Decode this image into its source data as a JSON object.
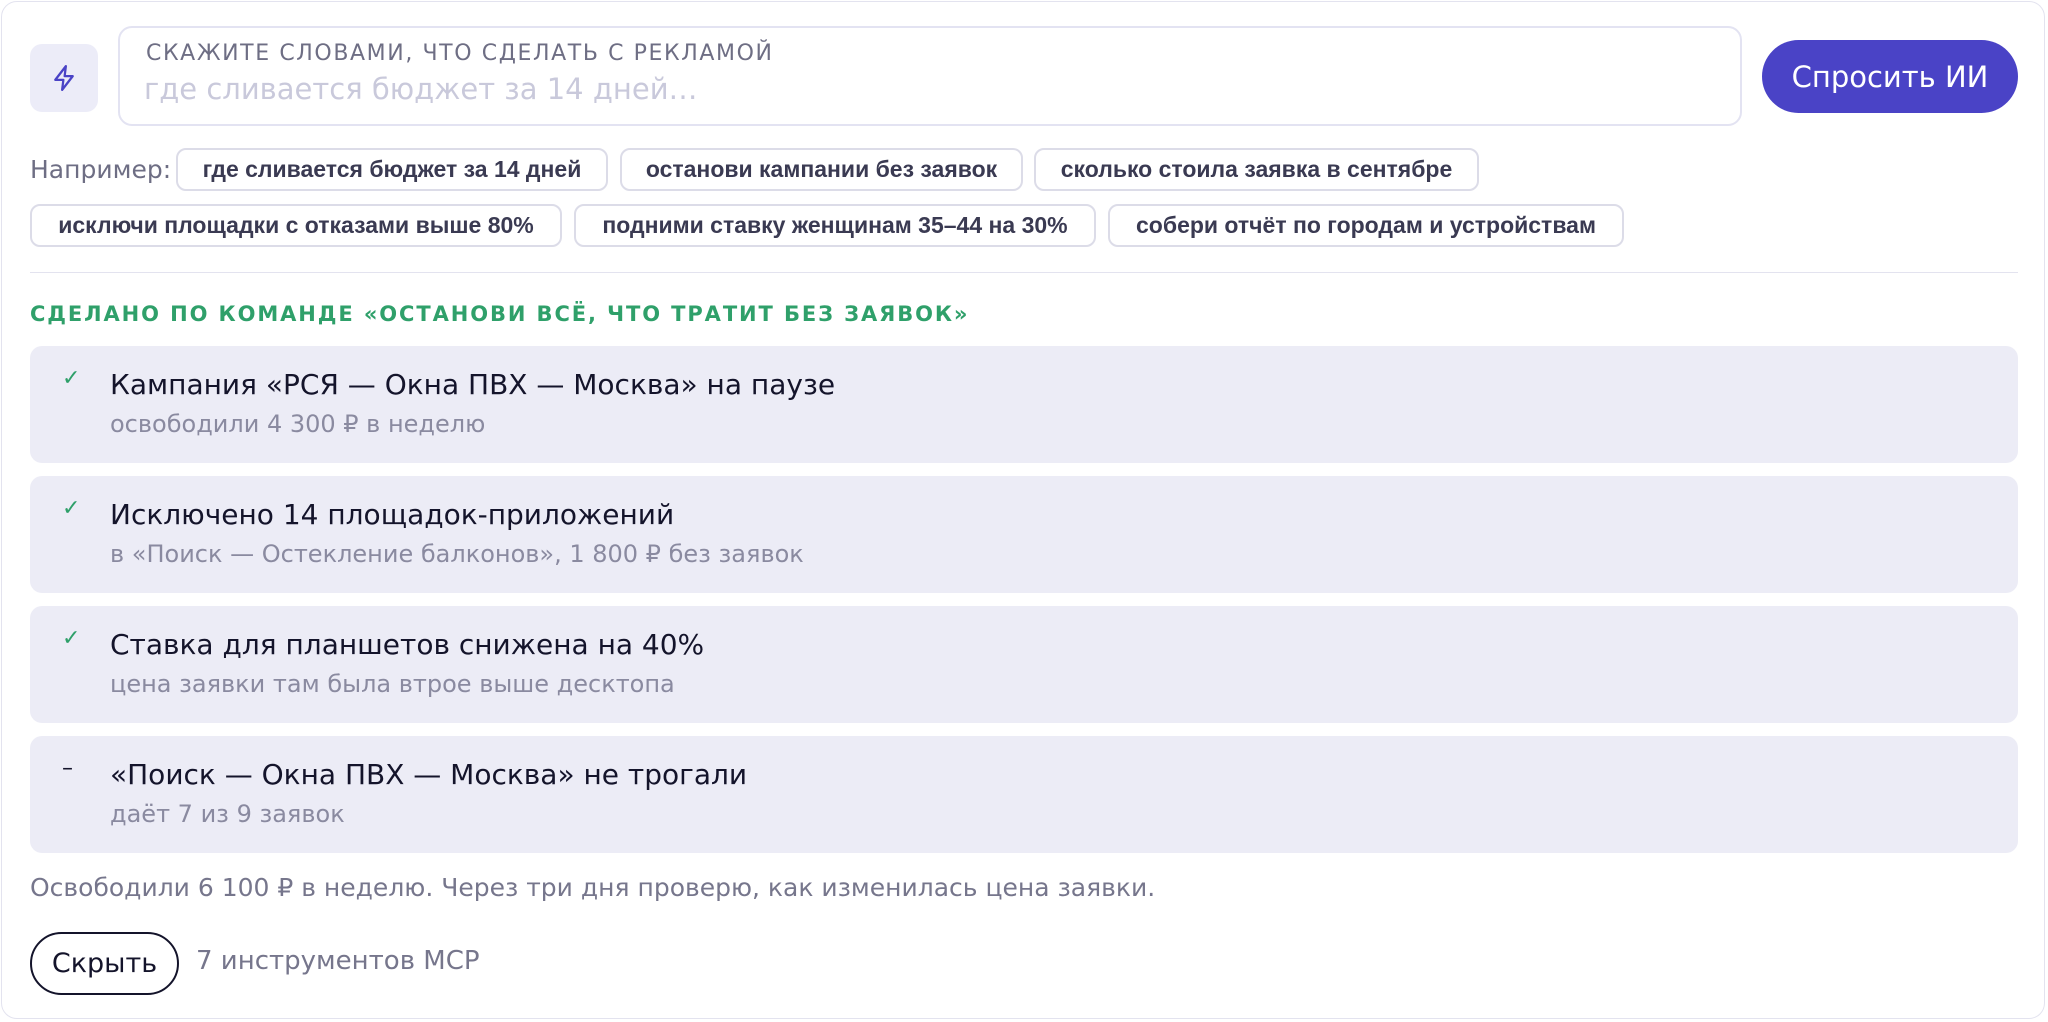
{
  "command_bar": {
    "label": "СКАЖИТЕ СЛОВАМИ, ЧТО СДЕЛАТЬ С РЕКЛАМОЙ",
    "placeholder": "где сливается бюджет за 14 дней…",
    "value": "",
    "submit_label": "Спросить ИИ",
    "icon": "bolt-icon"
  },
  "examples": {
    "label": "Например:",
    "items": [
      "где сливается бюджет за 14 дней",
      "останови кампании без заявок",
      "сколько стоила заявка в сентябре",
      "исключи площадки с отказами выше 80%",
      "подними ставку женщинам 35–44 на 30%",
      "собери отчёт по городам и устройствам"
    ]
  },
  "results": {
    "heading": "СДЕЛАНО ПО КОМАНДЕ «ОСТАНОВИ ВСЁ, ЧТО ТРАТИТ БЕЗ ЗАЯВОК»",
    "items": [
      {
        "mark": "✓",
        "title": "Кампания «РСЯ — Окна ПВХ — Москва» на паузе",
        "subtitle": "освободили 4 300 ₽ в неделю"
      },
      {
        "mark": "✓",
        "title": "Исключено 14 площадок-приложений",
        "subtitle": "в «Поиск — Остекление балконов», 1 800 ₽ без заявок"
      },
      {
        "mark": "✓",
        "title": "Ставка для планшетов снижена на 40%",
        "subtitle": "цена заявки там была втрое выше десктопа"
      },
      {
        "mark": "–",
        "title": "«Поиск — Окна ПВХ — Москва» не трогали",
        "subtitle": "даёт 7 из 9 заявок"
      }
    ],
    "summary": "Освободили 6 100 ₽ в неделю. Через три дня проверю, как изменилась цена заявки."
  },
  "footer": {
    "hide_label": "Скрыть",
    "tools_count": "7 инструментов MCP"
  },
  "colors": {
    "accent": "#4a43c6",
    "success": "#2fa06a",
    "row_background": "#ececf6",
    "muted_text": "#76768c"
  }
}
